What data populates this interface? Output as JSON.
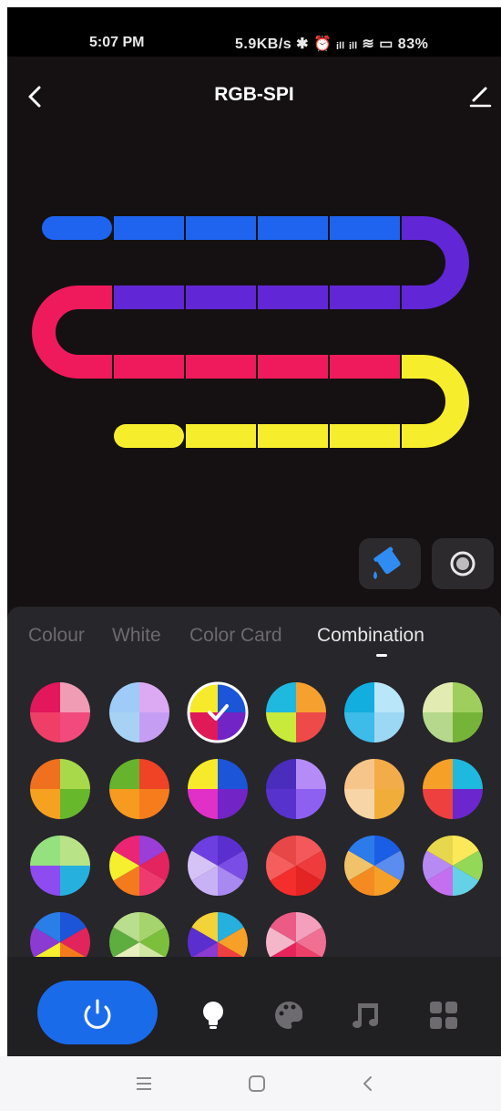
{
  "status_bar": {
    "time": "5:07 PM",
    "indicators": "5.9KB/s ✱ ⏰ ᵢₗₗ ᵢₗₗ ≋ ▭ 83%"
  },
  "header": {
    "title": "RGB-SPI",
    "back_icon": "chevron-left-icon",
    "edit_icon": "pencil-icon"
  },
  "strip": {
    "colors": {
      "blue": "#1e64ef",
      "purple": "#6126d6",
      "pink": "#ef1a5c",
      "yellow": "#f6ee2d"
    }
  },
  "tools": [
    {
      "icon": "paint-bucket-icon",
      "active": true
    },
    {
      "icon": "record-dot-icon",
      "active": false
    }
  ],
  "tabs": [
    {
      "label": "Colour",
      "active": false
    },
    {
      "label": "White",
      "active": false
    },
    {
      "label": "Color Card",
      "active": false
    },
    {
      "label": "Combination",
      "active": true
    }
  ],
  "combinations": [
    {
      "colors": [
        "#f09cb4",
        "#f24a7c",
        "#ef3f67",
        "#e2175c"
      ],
      "selected": false
    },
    {
      "colors": [
        "#dcaaf2",
        "#c59ef4",
        "#a8d2f4",
        "#9ecbf7"
      ],
      "selected": false
    },
    {
      "colors": [
        "#1c55d8",
        "#7224c6",
        "#e01a57",
        "#f7ea2a"
      ],
      "selected": true
    },
    {
      "colors": [
        "#f6a12f",
        "#ee4a49",
        "#c8ea3a",
        "#1fb8df"
      ],
      "selected": false
    },
    {
      "colors": [
        "#b9e6f9",
        "#9cd8f3",
        "#3dbbe9",
        "#11aedf"
      ],
      "selected": false
    },
    {
      "colors": [
        "#9fce5e",
        "#75b438",
        "#b5d88c",
        "#e2ecb2"
      ],
      "selected": false
    },
    {
      "colors": [
        "#a8d94a",
        "#68b82c",
        "#f6a120",
        "#ef701f"
      ],
      "selected": false
    },
    {
      "colors": [
        "#f04224",
        "#f77d1c",
        "#f69a20",
        "#68b32d"
      ],
      "selected": false
    },
    {
      "colors": [
        "#1c55d8",
        "#7224c6",
        "#e030c7",
        "#f7ea2a"
      ],
      "selected": false
    },
    {
      "colors": [
        "#b58cf7",
        "#8e60f2",
        "#5832cd",
        "#4a2dbd"
      ],
      "selected": false
    },
    {
      "colors": [
        "#f3ac4a",
        "#f1ad3a",
        "#f8d5a6",
        "#f6c58a"
      ],
      "selected": false
    },
    {
      "colors": [
        "#1fb8df",
        "#6b26ce",
        "#ef4040",
        "#f6a028"
      ],
      "selected": false
    },
    {
      "colors": [
        "#b9e387",
        "#25b0de",
        "#8e4bef",
        "#95e07f"
      ],
      "selected": false
    },
    {
      "colors": [
        "#9b3dd7",
        "#e3245f",
        "#ef3a70",
        "#f37b1d",
        "#f5ef2d",
        "#eb2574"
      ],
      "selected": false
    },
    {
      "colors": [
        "#5b2ed0",
        "#7a4de6",
        "#a888f1",
        "#c9b1f5",
        "#d5c3f8",
        "#6d3fe0"
      ],
      "selected": false
    },
    {
      "colors": [
        "#f4585b",
        "#ef3b3b",
        "#e42323",
        "#f42d2d",
        "#f65d5d",
        "#e84747"
      ],
      "selected": false
    },
    {
      "colors": [
        "#1a5ee6",
        "#5b8cf0",
        "#f6a028",
        "#f38b21",
        "#f0c36a",
        "#2c7bea"
      ],
      "selected": false
    },
    {
      "colors": [
        "#fbe95a",
        "#94d858",
        "#65d1e6",
        "#c46ef0",
        "#b78af3",
        "#e6d74c"
      ],
      "selected": false
    },
    {
      "colors": [
        "#1c55d8",
        "#e2245c",
        "#f37b1d",
        "#f5ef2d",
        "#8b3ad2",
        "#2a7ee8"
      ],
      "selected": false
    },
    {
      "colors": [
        "#a6d46c",
        "#7cbf3d",
        "#d0e7a4",
        "#e7efbf",
        "#5eae3f",
        "#b9de8d"
      ],
      "selected": false
    },
    {
      "colors": [
        "#25b0de",
        "#f6a028",
        "#ef4040",
        "#8b3ad2",
        "#5b2ed0",
        "#f3d23a"
      ],
      "selected": false
    },
    {
      "colors": [
        "#f4a0bc",
        "#f06f92",
        "#ee3f69",
        "#e4245b",
        "#f4b6c9",
        "#ea5b85"
      ],
      "selected": false
    }
  ],
  "bottom_nav": [
    {
      "icon": "power-icon",
      "active": true
    },
    {
      "icon": "lightbulb-icon",
      "active": false
    },
    {
      "icon": "palette-icon",
      "active": false
    },
    {
      "icon": "music-note-icon",
      "active": false
    },
    {
      "icon": "grid-icon",
      "active": false
    }
  ],
  "system_nav": [
    {
      "icon": "menu-icon"
    },
    {
      "icon": "home-square-icon"
    },
    {
      "icon": "back-chevron-icon"
    }
  ]
}
